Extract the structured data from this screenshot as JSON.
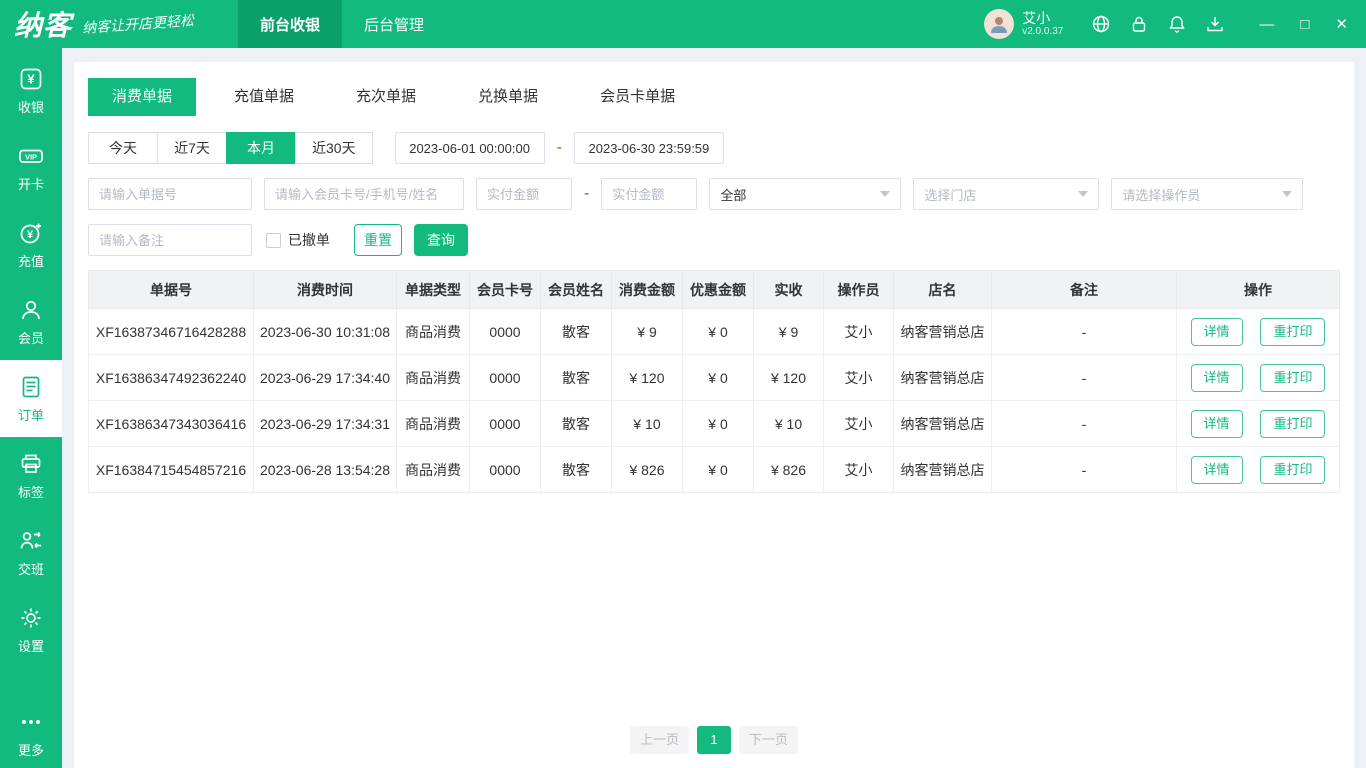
{
  "colors": {
    "primary": "#13ba7d",
    "primary_dark": "#0aa169",
    "panel_bg": "#ffffff",
    "page_bg": "#edf0f4"
  },
  "topbar": {
    "logo": "纳客",
    "slogan": "纳客让开店更轻松",
    "nav": [
      {
        "label": "前台收银",
        "active": true
      },
      {
        "label": "后台管理",
        "active": false
      }
    ],
    "user": {
      "name": "艾小",
      "version": "v2.0.0.37"
    },
    "icons": [
      {
        "name": "globe-icon"
      },
      {
        "name": "lock-icon"
      },
      {
        "name": "bell-icon"
      },
      {
        "name": "download-icon"
      }
    ],
    "window_controls": {
      "minimize": "—",
      "maximize": "□",
      "close": "✕"
    }
  },
  "sidebar": {
    "items": [
      {
        "label": "收银",
        "icon": "cashier-icon",
        "active": false
      },
      {
        "label": "开卡",
        "icon": "vip-card-icon",
        "active": false
      },
      {
        "label": "充值",
        "icon": "recharge-icon",
        "active": false
      },
      {
        "label": "会员",
        "icon": "member-icon",
        "active": false
      },
      {
        "label": "订单",
        "icon": "order-icon",
        "active": true
      },
      {
        "label": "标签",
        "icon": "label-printer-icon",
        "active": false
      },
      {
        "label": "交班",
        "icon": "shift-icon",
        "active": false
      },
      {
        "label": "设置",
        "icon": "settings-gear-icon",
        "active": false
      },
      {
        "label": "更多",
        "icon": "more-dots-icon",
        "active": false
      }
    ]
  },
  "doc_tabs": [
    {
      "label": "消费单据",
      "active": true
    },
    {
      "label": "充值单据",
      "active": false
    },
    {
      "label": "充次单据",
      "active": false
    },
    {
      "label": "兑换单据",
      "active": false
    },
    {
      "label": "会员卡单据",
      "active": false
    }
  ],
  "filters": {
    "quick_ranges": [
      {
        "label": "今天",
        "active": false
      },
      {
        "label": "近7天",
        "active": false
      },
      {
        "label": "本月",
        "active": true
      },
      {
        "label": "近30天",
        "active": false
      }
    ],
    "date_from": "2023-06-01 00:00:00",
    "date_to": "2023-06-30 23:59:59",
    "separator": "-",
    "placeholders": {
      "order_no": "请输入单据号",
      "member": "请输入会员卡号/手机号/姓名",
      "amount_min": "实付金额",
      "amount_max": "实付金额",
      "remark": "请输入备注"
    },
    "selects": {
      "type": "全部",
      "store": "选择门店",
      "operator": "请选择操作员"
    },
    "revoked_label": "已撤单",
    "reset_label": "重置",
    "search_label": "查询"
  },
  "table": {
    "headers": [
      "单据号",
      "消费时间",
      "单据类型",
      "会员卡号",
      "会员姓名",
      "消费金额",
      "优惠金额",
      "实收",
      "操作员",
      "店名",
      "备注",
      "操作"
    ],
    "actions": {
      "detail": "详情",
      "reprint": "重打印"
    },
    "rows": [
      [
        "XF16387346716428288",
        "2023-06-30 10:31:08",
        "商品消费",
        "0000",
        "散客",
        "¥ 9",
        "¥ 0",
        "¥ 9",
        "艾小",
        "纳客营销总店",
        "-"
      ],
      [
        "XF16386347492362240",
        "2023-06-29 17:34:40",
        "商品消费",
        "0000",
        "散客",
        "¥ 120",
        "¥ 0",
        "¥ 120",
        "艾小",
        "纳客营销总店",
        "-"
      ],
      [
        "XF16386347343036416",
        "2023-06-29 17:34:31",
        "商品消费",
        "0000",
        "散客",
        "¥ 10",
        "¥ 0",
        "¥ 10",
        "艾小",
        "纳客营销总店",
        "-"
      ],
      [
        "XF16384715454857216",
        "2023-06-28 13:54:28",
        "商品消费",
        "0000",
        "散客",
        "¥ 826",
        "¥ 0",
        "¥ 826",
        "艾小",
        "纳客营销总店",
        "-"
      ]
    ]
  },
  "pagination": {
    "prev": "上一页",
    "page": "1",
    "next": "下一页"
  }
}
